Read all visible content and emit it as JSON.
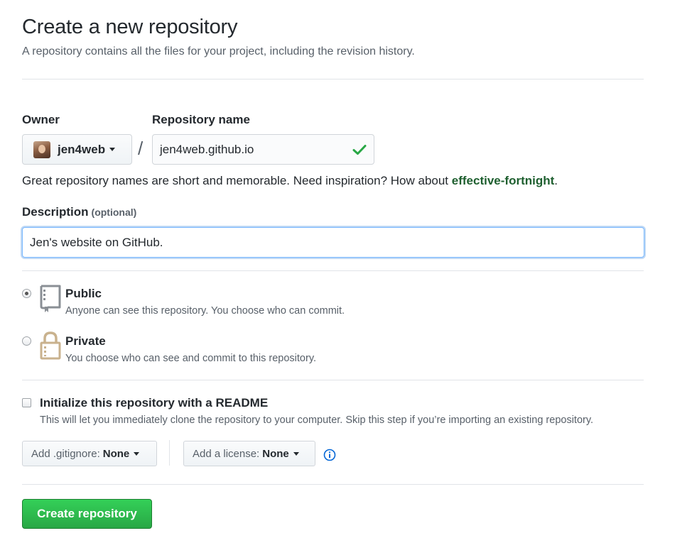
{
  "header": {
    "title": "Create a new repository",
    "subtitle": "A repository contains all the files for your project, including the revision history."
  },
  "owner": {
    "label": "Owner",
    "selected": "jen4web"
  },
  "separator": "/",
  "repository_name": {
    "label": "Repository name",
    "value": "jen4web.github.io",
    "status_icon": "check-icon"
  },
  "name_hint": {
    "prefix": "Great repository names are short and memorable. Need inspiration? How about ",
    "suggestion": "effective-fortnight",
    "suffix": "."
  },
  "description": {
    "label": "Description",
    "optional": "(optional)",
    "value": "Jen's website on GitHub."
  },
  "visibility": {
    "selected": "public",
    "options": [
      {
        "title": "Public",
        "description": "Anyone can see this repository. You choose who can commit.",
        "icon": "repo-book-icon"
      },
      {
        "title": "Private",
        "description": "You choose who can see and commit to this repository.",
        "icon": "lock-icon"
      }
    ]
  },
  "readme": {
    "label": "Initialize this repository with a README",
    "description": "This will let you immediately clone the repository to your computer. Skip this step if you’re importing an existing repository.",
    "checked": false
  },
  "gitignore": {
    "label": "Add .gitignore:",
    "value": "None"
  },
  "license": {
    "label": "Add a license:",
    "value": "None"
  },
  "submit": {
    "label": "Create repository"
  },
  "colors": {
    "primary_button": "#28a745",
    "suggestion_link": "#1e5f2f",
    "focus_border": "#79b8ff",
    "info_icon": "#0366d6",
    "check_icon": "#28a745"
  }
}
